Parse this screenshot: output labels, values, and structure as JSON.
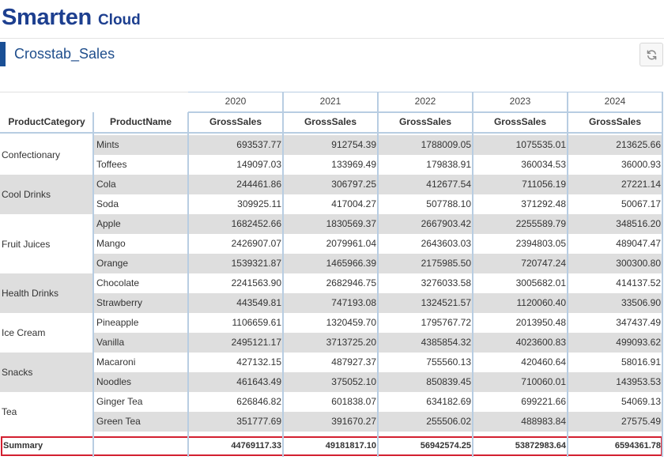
{
  "brand": {
    "name": "Smarten",
    "suffix": "Cloud"
  },
  "page": {
    "title": "Crosstab_Sales"
  },
  "toolbar": {
    "refresh_icon": "refresh-icon"
  },
  "crosstab": {
    "years": [
      "2020",
      "2021",
      "2022",
      "2023",
      "2024"
    ],
    "row_headers": {
      "category": "ProductCategory",
      "product": "ProductName"
    },
    "measure": "GrossSales",
    "categories": [
      {
        "name": "Confectionary",
        "rows": [
          {
            "product": "Mints",
            "values": [
              "693537.77",
              "912754.39",
              "1788009.05",
              "1075535.01",
              "213625.66"
            ]
          },
          {
            "product": "Toffees",
            "values": [
              "149097.03",
              "133969.49",
              "179838.91",
              "360034.53",
              "36000.93"
            ]
          }
        ]
      },
      {
        "name": "Cool Drinks",
        "rows": [
          {
            "product": "Cola",
            "values": [
              "244461.86",
              "306797.25",
              "412677.54",
              "711056.19",
              "27221.14"
            ]
          },
          {
            "product": "Soda",
            "values": [
              "309925.11",
              "417004.27",
              "507788.10",
              "371292.48",
              "50067.17"
            ]
          }
        ]
      },
      {
        "name": "Fruit Juices",
        "rows": [
          {
            "product": "Apple",
            "values": [
              "1682452.66",
              "1830569.37",
              "2667903.42",
              "2255589.79",
              "348516.20"
            ]
          },
          {
            "product": "Mango",
            "values": [
              "2426907.07",
              "2079961.04",
              "2643603.03",
              "2394803.05",
              "489047.47"
            ]
          },
          {
            "product": "Orange",
            "values": [
              "1539321.87",
              "1465966.39",
              "2175985.50",
              "720747.24",
              "300300.80"
            ]
          }
        ]
      },
      {
        "name": "Health Drinks",
        "rows": [
          {
            "product": "Chocolate",
            "values": [
              "2241563.90",
              "2682946.75",
              "3276033.58",
              "3005682.01",
              "414137.52"
            ]
          },
          {
            "product": "Strawberry",
            "values": [
              "443549.81",
              "747193.08",
              "1324521.57",
              "1120060.40",
              "33506.90"
            ]
          }
        ]
      },
      {
        "name": "Ice Cream",
        "rows": [
          {
            "product": "Pineapple",
            "values": [
              "1106659.61",
              "1320459.70",
              "1795767.72",
              "2013950.48",
              "347437.49"
            ]
          },
          {
            "product": "Vanilla",
            "values": [
              "2495121.17",
              "3713725.20",
              "4385854.32",
              "4023600.83",
              "499093.62"
            ]
          }
        ]
      },
      {
        "name": "Snacks",
        "rows": [
          {
            "product": "Macaroni",
            "values": [
              "427132.15",
              "487927.37",
              "755560.13",
              "420460.64",
              "58016.91"
            ]
          },
          {
            "product": "Noodles",
            "values": [
              "461643.49",
              "375052.10",
              "850839.45",
              "710060.01",
              "143953.53"
            ]
          }
        ]
      },
      {
        "name": "Tea",
        "rows": [
          {
            "product": "Ginger Tea",
            "values": [
              "626846.82",
              "601838.07",
              "634182.69",
              "699221.66",
              "54069.13"
            ]
          },
          {
            "product": "Green Tea",
            "values": [
              "351777.69",
              "391670.27",
              "255506.02",
              "488983.84",
              "27575.49"
            ]
          }
        ]
      }
    ],
    "summary": {
      "label": "Summary",
      "values": [
        "44769117.33",
        "49181817.10",
        "56942574.25",
        "53872983.64",
        "6594361.78"
      ]
    }
  }
}
